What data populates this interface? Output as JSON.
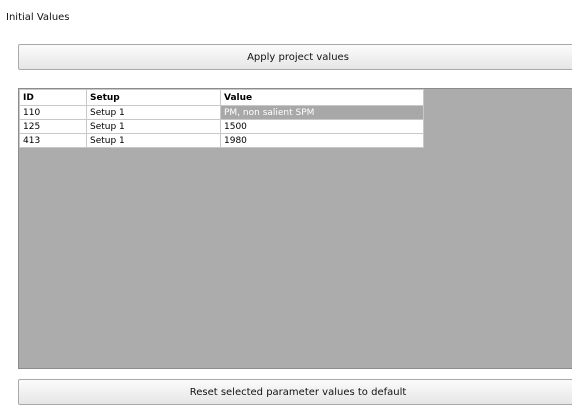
{
  "section": {
    "title": "Initial Values"
  },
  "buttons": {
    "apply_label": "Apply project values",
    "reset_label": "Reset selected parameter values to default"
  },
  "table": {
    "columns": [
      "ID",
      "Setup",
      "Value"
    ],
    "rows": [
      {
        "id": "110",
        "setup": "Setup 1",
        "value": "PM, non salient SPM",
        "selected_value": true
      },
      {
        "id": "125",
        "setup": "Setup 1",
        "value": "1500"
      },
      {
        "id": "413",
        "setup": "Setup 1",
        "value": "1980"
      }
    ]
  },
  "colors": {
    "grid_background": "#acacac",
    "selected_cell": "#a8a8a8"
  }
}
